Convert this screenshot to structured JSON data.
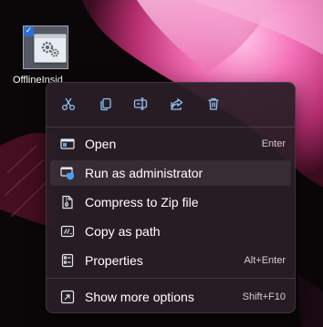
{
  "desktop": {
    "file_icon": {
      "label": "OfflineInsid",
      "icon": "settings-gears-icon",
      "selected": true
    }
  },
  "context_menu": {
    "quick_actions": [
      {
        "id": "cut",
        "icon": "cut-icon"
      },
      {
        "id": "copy",
        "icon": "copy-icon"
      },
      {
        "id": "rename",
        "icon": "rename-icon"
      },
      {
        "id": "share",
        "icon": "share-icon"
      },
      {
        "id": "delete",
        "icon": "delete-icon"
      }
    ],
    "items": [
      {
        "label": "Open",
        "shortcut": "Enter",
        "icon": "open-app-icon"
      },
      {
        "label": "Run as administrator",
        "shortcut": "",
        "icon": "run-as-admin-icon",
        "highlighted": true
      },
      {
        "label": "Compress to Zip file",
        "shortcut": "",
        "icon": "zip-file-icon"
      },
      {
        "label": "Copy as path",
        "shortcut": "",
        "icon": "copy-path-icon"
      },
      {
        "label": "Properties",
        "shortcut": "Alt+Enter",
        "icon": "properties-icon"
      }
    ],
    "footer_item": {
      "label": "Show more options",
      "shortcut": "Shift+F10",
      "icon": "show-more-options-icon"
    }
  },
  "colors": {
    "accent": "#4c9ef0",
    "menu_background": "#2b1e26",
    "text": "#ffffff"
  }
}
